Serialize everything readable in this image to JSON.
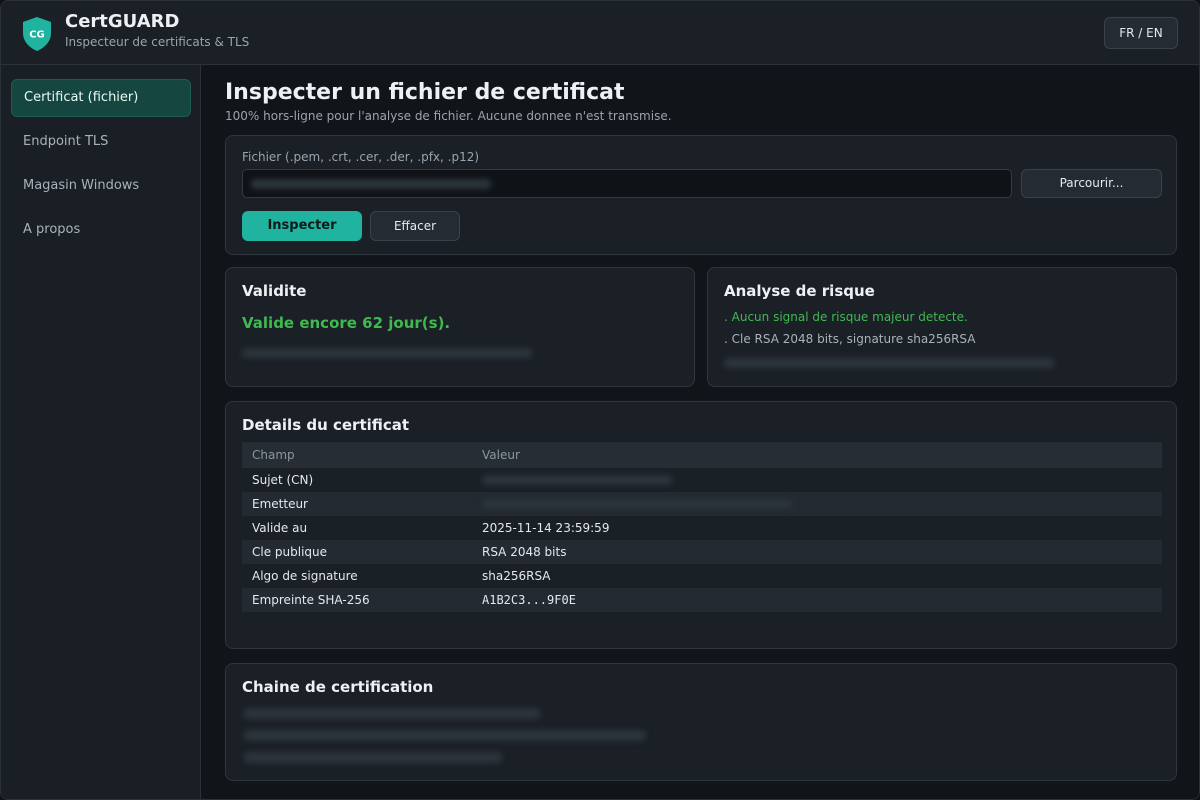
{
  "app": {
    "name": "CertGUARD",
    "subtitle": "Inspecteur de certificats & TLS",
    "logo_text": "CG",
    "lang_button": "FR / EN"
  },
  "sidebar": {
    "items": [
      {
        "label": "Certificat (fichier)",
        "active": true
      },
      {
        "label": "Endpoint TLS",
        "active": false
      },
      {
        "label": "Magasin Windows",
        "active": false
      },
      {
        "label": "A propos",
        "active": false
      }
    ]
  },
  "main": {
    "title": "Inspecter un fichier de certificat",
    "subtitle": "100% hors-ligne pour l'analyse de fichier. Aucune donnee n'est transmise.",
    "file": {
      "label": "Fichier (.pem, .crt, .cer, .der, .pfx, .p12)",
      "browse_label": "Parcourir...",
      "inspect_label": "Inspecter",
      "clear_label": "Effacer"
    },
    "validity": {
      "title": "Validite",
      "status": "Valide encore 62 jour(s)."
    },
    "risk": {
      "title": "Analyse de risque",
      "ok_line": ". Aucun signal de risque majeur detecte.",
      "info_line": ". Cle RSA 2048 bits, signature sha256RSA"
    },
    "details": {
      "title": "Details du certificat",
      "headers": {
        "field": "Champ",
        "value": "Valeur"
      },
      "rows": [
        {
          "field": "Sujet (CN)",
          "value": ""
        },
        {
          "field": "Emetteur",
          "value": ""
        },
        {
          "field": "Valide au",
          "value": "2025-11-14 23:59:59"
        },
        {
          "field": "Cle publique",
          "value": "RSA 2048 bits"
        },
        {
          "field": "Algo de signature",
          "value": "sha256RSA"
        },
        {
          "field": "Empreinte SHA-256",
          "value": "A1B2C3...9F0E"
        }
      ]
    },
    "chain": {
      "title": "Chaine de certification"
    }
  },
  "colors": {
    "accent": "#1fb3a0",
    "success": "#3fb950",
    "sidebar_active": "#15463f"
  }
}
